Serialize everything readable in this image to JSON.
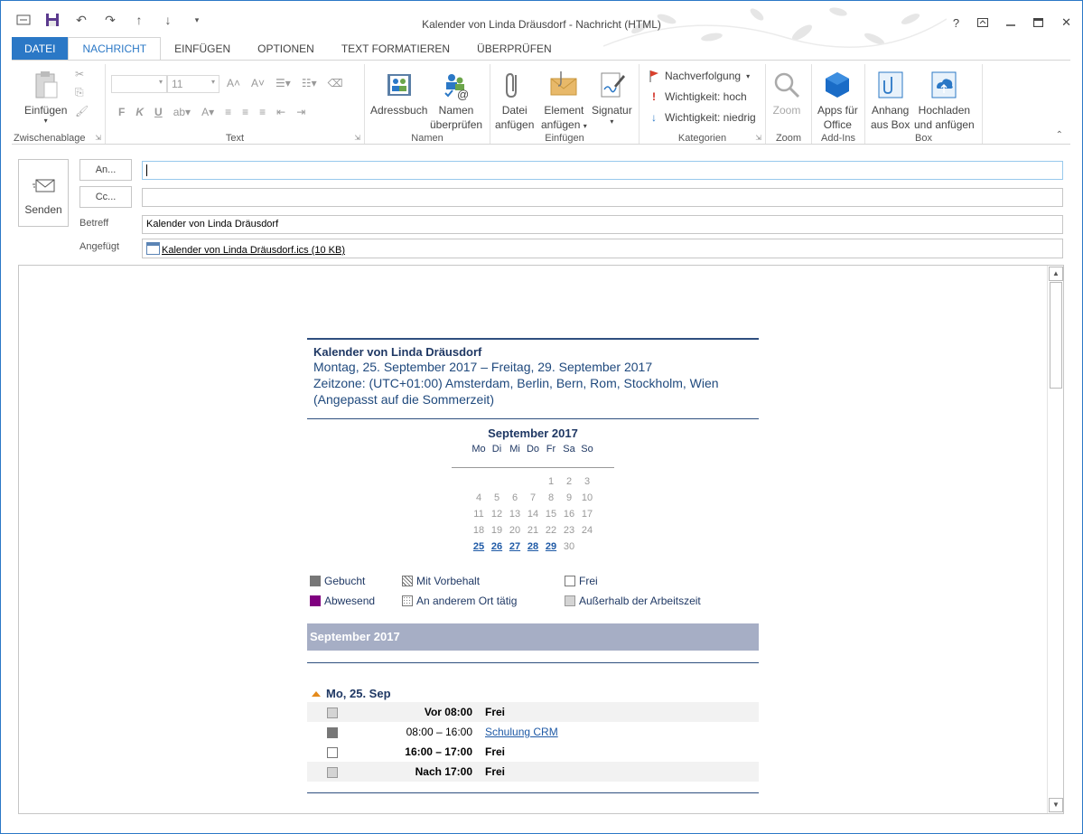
{
  "window": {
    "title": "Kalender von Linda Dräusdorf - Nachricht (HTML)",
    "help_label": "?",
    "accent_color": "#2b78c6"
  },
  "tabs": [
    "DATEI",
    "NACHRICHT",
    "EINFÜGEN",
    "OPTIONEN",
    "TEXT FORMATIEREN",
    "ÜBERPRÜFEN"
  ],
  "ribbon": {
    "clipboard": {
      "paste_label": "Einfügen",
      "group_label": "Zwischenablage"
    },
    "text": {
      "font_size": "11",
      "bold": "F",
      "italic": "K",
      "underline": "U",
      "group_label": "Text"
    },
    "names": {
      "address_book": "Adressbuch",
      "check_names_1": "Namen",
      "check_names_2": "überprüfen",
      "group_label": "Namen"
    },
    "insert": {
      "attach_file_1": "Datei",
      "attach_file_2": "anfügen",
      "attach_item_1": "Element",
      "attach_item_2": "anfügen",
      "signature": "Signatur",
      "group_label": "Einfügen"
    },
    "tags": {
      "follow_up": "Nachverfolgung",
      "high": "Wichtigkeit: hoch",
      "low": "Wichtigkeit: niedrig",
      "group_label": "Kategorien"
    },
    "zoom": {
      "label": "Zoom",
      "group_label": "Zoom"
    },
    "addins": {
      "apps_1": "Apps für",
      "apps_2": "Office",
      "group_label": "Add-Ins"
    },
    "box": {
      "attach_1": "Anhang",
      "attach_2": "aus Box",
      "upload_1": "Hochladen",
      "upload_2": "und anfügen",
      "group_label": "Box"
    }
  },
  "compose": {
    "send_label": "Senden",
    "to_button": "An...",
    "cc_button": "Cc...",
    "to_value": "",
    "cc_value": "",
    "subject_label": "Betreff",
    "subject_value": "Kalender von Linda Dräusdorf",
    "attached_label": "Angefügt",
    "attachment": "Kalender von Linda Dräusdorf.ics (10 KB)"
  },
  "calendar": {
    "title": "Kalender von Linda Dräusdorf",
    "range": "Montag, 25. September 2017 – Freitag, 29. September 2017",
    "timezone": "Zeitzone: (UTC+01:00) Amsterdam, Berlin, Bern, Rom, Stockholm, Wien",
    "dst_note": "(Angepasst auf die Sommerzeit)",
    "month_title": "September 2017",
    "weekdays": [
      "Mo",
      "Di",
      "Mi",
      "Do",
      "Fr",
      "Sa",
      "So"
    ],
    "weeks": [
      [
        "",
        "",
        "",
        "",
        "1",
        "2",
        "3"
      ],
      [
        "4",
        "5",
        "6",
        "7",
        "8",
        "9",
        "10"
      ],
      [
        "11",
        "12",
        "13",
        "14",
        "15",
        "16",
        "17"
      ],
      [
        "18",
        "19",
        "20",
        "21",
        "22",
        "23",
        "24"
      ],
      [
        "25",
        "26",
        "27",
        "28",
        "29",
        "30",
        ""
      ]
    ],
    "highlighted_days": [
      "25",
      "26",
      "27",
      "28",
      "29"
    ],
    "legend": {
      "busy": "Gebucht",
      "tentative": "Mit Vorbehalt",
      "free": "Frei",
      "oof": "Abwesend",
      "elsewhere": "An anderem Ort tätig",
      "outside": "Außerhalb der Arbeitszeit"
    },
    "month_bar": "September 2017",
    "day_heading": "Mo, 25. Sep",
    "slots": [
      {
        "time": "Vor 08:00",
        "desc": "Frei"
      },
      {
        "time": "08:00 – 16:00",
        "desc": "Schulung CRM"
      },
      {
        "time": "16:00 – 17:00",
        "desc": "Frei"
      },
      {
        "time": "Nach 17:00",
        "desc": "Frei"
      }
    ]
  }
}
